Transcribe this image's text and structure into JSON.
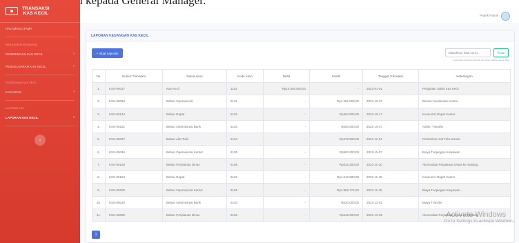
{
  "document_caption": "untuk diteruskan kepada General Manager.",
  "sidebar": {
    "brand": [
      "TRANSAKSI",
      "KAS KECIL"
    ],
    "dashboard_label": "HALAMAN UTAMA",
    "section_manajemen": "MANAJEMEN KEUANGAN",
    "item_penerimaan": "PENERIMAAN KAS KECIL",
    "item_pengeluaran": "PENGELUARAN KAS KECIL",
    "section_persediaan": "PERSEDIAAN KAS KECIL",
    "item_kas_kecil": "KAS KECIL",
    "section_laporan": "LAPORAN KAS",
    "item_laporan": "LAPORAN KAS KECIL",
    "toggle_glyph": "‹"
  },
  "topbar": {
    "user_name": "Pabrik Pabrik"
  },
  "card": {
    "title": "LAPORAN KEUANGAN KAS KECIL",
    "create_button": "Buat Laporan",
    "search_placeholder": "Masukkan kata kunci...",
    "search_button": "Cari",
    "search_hint": "Kosongkan pencarian lalu klik cari untuk melihat semua data"
  },
  "table": {
    "columns": [
      "No.",
      "Nomor Transaksi",
      "Nama Akun",
      "Kode Akun",
      "Debit",
      "Kredit",
      "Tanggal Transaksi",
      "Keterangan"
    ],
    "rows": [
      [
        "1.",
        "KSS-00017",
        "Kas Kecil",
        "1102",
        "Rp10.000.000,00",
        "-",
        "2022-01-01",
        "Pengisian Saldo Kas Kecil"
      ],
      [
        "2.",
        "KSS-00058",
        "Beban Operasional",
        "5101",
        "-",
        "Rp1.262.000,00",
        "2022-10-07",
        "Bensin Kendaraan Kantor"
      ],
      [
        "3.",
        "KSS-00144",
        "Beban Rapat",
        "5102",
        "-",
        "Rp464.000,00",
        "2022-10-17",
        "Konsumsi Rapat Kantor"
      ],
      [
        "4.",
        "KSS-00231",
        "Beban Administrasi Bank",
        "5103",
        "-",
        "Rp60.000,00",
        "2022-10-27",
        "Admin Transfer"
      ],
      [
        "5.",
        "KSS-00037",
        "Beban Alat Tulis",
        "5104",
        "-",
        "Rp478.000,00",
        "2022-11-04",
        "Pembelian Alat Tulis Kantor"
      ],
      [
        "6.",
        "KSS-00045",
        "Beban Operasional Kantor",
        "5105",
        "-",
        "Rp953.200,00",
        "2022-11-07",
        "Biaya Tunjangan Karyawan"
      ],
      [
        "7.",
        "KSS-00100",
        "Beban Perjalanan Dinas",
        "5106",
        "-",
        "Rp616.200,00",
        "2022-11-10",
        "Akomodasi Perjalanan Dinas ke Subang"
      ],
      [
        "8.",
        "KSS-00164",
        "Beban Rapat",
        "5102",
        "-",
        "Rp1.040.580,00",
        "2022-11-18",
        "Konsumsi Rapat Kantor"
      ],
      [
        "9.",
        "KSS-00200",
        "Beban Operasional Kantor",
        "5105",
        "-",
        "Rp1.858.774,00",
        "2022-11-25",
        "Biaya Tunjangan Karyawan"
      ],
      [
        "10.",
        "KSS-00026",
        "Beban Administrasi Bank",
        "5103",
        "-",
        "Rp30.000,00",
        "2022-12-02",
        "Biaya Transfer"
      ],
      [
        "11.",
        "KSS-00085",
        "Beban Perjalanan Dinas",
        "5106",
        "-",
        "Rp645.000,00",
        "2022-12-09",
        "Akomodasi Perjalanan Dinas ke Subang"
      ]
    ]
  },
  "pagination": {
    "current_page": "1"
  },
  "watermark": {
    "title": "Activate Windows",
    "subtitle": "Go to Settings to activate Windows."
  }
}
